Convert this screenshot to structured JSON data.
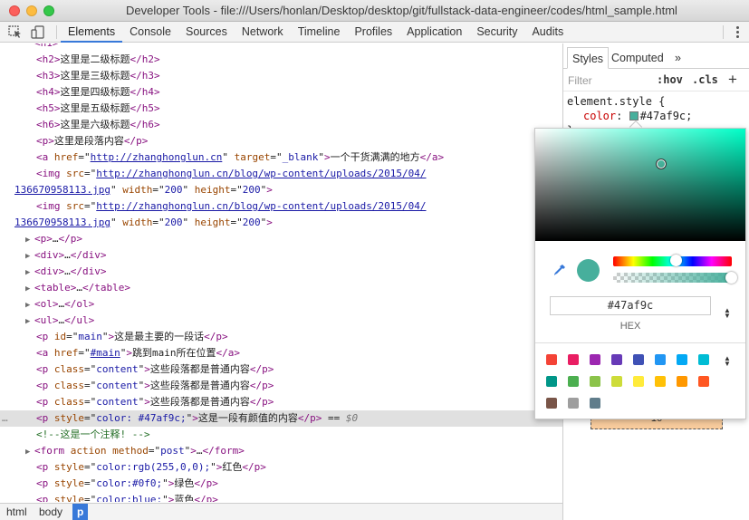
{
  "window": {
    "title": "Developer Tools - file:///Users/honlan/Desktop/desktop/git/fullstack-data-engineer/codes/html_sample.html"
  },
  "toolbar": {
    "tabs": [
      "Elements",
      "Console",
      "Sources",
      "Network",
      "Timeline",
      "Profiles",
      "Application",
      "Security",
      "Audits"
    ],
    "active_tab": "Elements"
  },
  "dom": {
    "lines": [
      {
        "indent": 3,
        "tokens": [
          [
            "tag",
            "<h2>"
          ],
          [
            "txt",
            "这里是二级标题"
          ],
          [
            "tag",
            "</h2>"
          ]
        ]
      },
      {
        "indent": 3,
        "tokens": [
          [
            "tag",
            "<h3>"
          ],
          [
            "txt",
            "这里是三级标题"
          ],
          [
            "tag",
            "</h3>"
          ]
        ]
      },
      {
        "indent": 3,
        "tokens": [
          [
            "tag",
            "<h4>"
          ],
          [
            "txt",
            "这里是四级标题"
          ],
          [
            "tag",
            "</h4>"
          ]
        ]
      },
      {
        "indent": 3,
        "tokens": [
          [
            "tag",
            "<h5>"
          ],
          [
            "txt",
            "这里是五级标题"
          ],
          [
            "tag",
            "</h5>"
          ]
        ]
      },
      {
        "indent": 3,
        "tokens": [
          [
            "tag",
            "<h6>"
          ],
          [
            "txt",
            "这里是六级标题"
          ],
          [
            "tag",
            "</h6>"
          ]
        ]
      },
      {
        "indent": 3,
        "tokens": [
          [
            "tag",
            "<p>"
          ],
          [
            "txt",
            "这里是段落内容"
          ],
          [
            "tag",
            "</p>"
          ]
        ]
      },
      {
        "indent": 3,
        "tokens": [
          [
            "tag",
            "<a "
          ],
          [
            "attr",
            "href"
          ],
          [
            "eq",
            "=\""
          ],
          [
            "link",
            "http://zhanghonglun.cn"
          ],
          [
            "eq",
            "\" "
          ],
          [
            "attr",
            "target"
          ],
          [
            "eq",
            "=\""
          ],
          [
            "val",
            "_blank"
          ],
          [
            "eq",
            "\""
          ],
          [
            "tag",
            ">"
          ],
          [
            "txt",
            "一个干货满满的地方"
          ],
          [
            "tag",
            "</a>"
          ]
        ]
      },
      {
        "indent": 3,
        "tokens": [
          [
            "tag",
            "<img "
          ],
          [
            "attr",
            "src"
          ],
          [
            "eq",
            "=\""
          ],
          [
            "link",
            "http://zhanghonglun.cn/blog/wp-content/uploads/2015/04/"
          ]
        ]
      },
      {
        "indent": 1,
        "tokens": [
          [
            "link",
            "136670958113.jpg"
          ],
          [
            "eq",
            "\" "
          ],
          [
            "attr",
            "width"
          ],
          [
            "eq",
            "=\""
          ],
          [
            "val",
            "200"
          ],
          [
            "eq",
            "\" "
          ],
          [
            "attr",
            "height"
          ],
          [
            "eq",
            "=\""
          ],
          [
            "val",
            "200"
          ],
          [
            "eq",
            "\""
          ],
          [
            "tag",
            ">"
          ]
        ]
      },
      {
        "indent": 3,
        "tokens": [
          [
            "tag",
            "<img "
          ],
          [
            "attr",
            "src"
          ],
          [
            "eq",
            "=\""
          ],
          [
            "link",
            "http://zhanghonglun.cn/blog/wp-content/uploads/2015/04/"
          ]
        ]
      },
      {
        "indent": 1,
        "tokens": [
          [
            "link",
            "136670958113.jpg"
          ],
          [
            "eq",
            "\" "
          ],
          [
            "attr",
            "width"
          ],
          [
            "eq",
            "=\""
          ],
          [
            "val",
            "200"
          ],
          [
            "eq",
            "\" "
          ],
          [
            "attr",
            "height"
          ],
          [
            "eq",
            "=\""
          ],
          [
            "val",
            "200"
          ],
          [
            "eq",
            "\""
          ],
          [
            "tag",
            ">"
          ]
        ]
      },
      {
        "indent": 2,
        "arrow": true,
        "tokens": [
          [
            "tag",
            "<p>"
          ],
          [
            "txt",
            "…"
          ],
          [
            "tag",
            "</p>"
          ]
        ]
      },
      {
        "indent": 2,
        "arrow": true,
        "tokens": [
          [
            "tag",
            "<div>"
          ],
          [
            "txt",
            "…"
          ],
          [
            "tag",
            "</div>"
          ]
        ]
      },
      {
        "indent": 2,
        "arrow": true,
        "tokens": [
          [
            "tag",
            "<div>"
          ],
          [
            "txt",
            "…"
          ],
          [
            "tag",
            "</div>"
          ]
        ]
      },
      {
        "indent": 2,
        "arrow": true,
        "tokens": [
          [
            "tag",
            "<table>"
          ],
          [
            "txt",
            "…"
          ],
          [
            "tag",
            "</table>"
          ]
        ]
      },
      {
        "indent": 2,
        "arrow": true,
        "tokens": [
          [
            "tag",
            "<ol>"
          ],
          [
            "txt",
            "…"
          ],
          [
            "tag",
            "</ol>"
          ]
        ]
      },
      {
        "indent": 2,
        "arrow": true,
        "tokens": [
          [
            "tag",
            "<ul>"
          ],
          [
            "txt",
            "…"
          ],
          [
            "tag",
            "</ul>"
          ]
        ]
      },
      {
        "indent": 3,
        "tokens": [
          [
            "tag",
            "<p "
          ],
          [
            "attr",
            "id"
          ],
          [
            "eq",
            "=\""
          ],
          [
            "val",
            "main"
          ],
          [
            "eq",
            "\""
          ],
          [
            "tag",
            ">"
          ],
          [
            "txt",
            "这是最主要的一段话"
          ],
          [
            "tag",
            "</p>"
          ]
        ]
      },
      {
        "indent": 3,
        "tokens": [
          [
            "tag",
            "<a "
          ],
          [
            "attr",
            "href"
          ],
          [
            "eq",
            "=\""
          ],
          [
            "link",
            "#main"
          ],
          [
            "eq",
            "\""
          ],
          [
            "tag",
            ">"
          ],
          [
            "txt",
            "跳到main所在位置"
          ],
          [
            "tag",
            "</a>"
          ]
        ]
      },
      {
        "indent": 3,
        "tokens": [
          [
            "tag",
            "<p "
          ],
          [
            "attr",
            "class"
          ],
          [
            "eq",
            "=\""
          ],
          [
            "val",
            "content"
          ],
          [
            "eq",
            "\""
          ],
          [
            "tag",
            ">"
          ],
          [
            "txt",
            "这些段落都是普通内容"
          ],
          [
            "tag",
            "</p>"
          ]
        ]
      },
      {
        "indent": 3,
        "tokens": [
          [
            "tag",
            "<p "
          ],
          [
            "attr",
            "class"
          ],
          [
            "eq",
            "=\""
          ],
          [
            "val",
            "content"
          ],
          [
            "eq",
            "\""
          ],
          [
            "tag",
            ">"
          ],
          [
            "txt",
            "这些段落都是普通内容"
          ],
          [
            "tag",
            "</p>"
          ]
        ]
      },
      {
        "indent": 3,
        "tokens": [
          [
            "tag",
            "<p "
          ],
          [
            "attr",
            "class"
          ],
          [
            "eq",
            "=\""
          ],
          [
            "val",
            "content"
          ],
          [
            "eq",
            "\""
          ],
          [
            "tag",
            ">"
          ],
          [
            "txt",
            "这些段落都是普通内容"
          ],
          [
            "tag",
            "</p>"
          ]
        ]
      },
      {
        "indent": 3,
        "selected": true,
        "tokens": [
          [
            "tag",
            "<p "
          ],
          [
            "attr",
            "style"
          ],
          [
            "eq",
            "=\""
          ],
          [
            "val",
            "color: #47af9c;"
          ],
          [
            "eq",
            "\""
          ],
          [
            "tag",
            ">"
          ],
          [
            "txt",
            "这是一段有颜值的内容"
          ],
          [
            "tag",
            "</p>"
          ],
          [
            "eq",
            " == "
          ],
          [
            "dim",
            "$0"
          ]
        ]
      },
      {
        "indent": 3,
        "tokens": [
          [
            "cmt",
            "<!--这是一个注释! -->"
          ]
        ]
      },
      {
        "indent": 2,
        "arrow": true,
        "tokens": [
          [
            "tag",
            "<form "
          ],
          [
            "attr",
            "action"
          ],
          [
            "eq",
            " "
          ],
          [
            "attr",
            "method"
          ],
          [
            "eq",
            "=\""
          ],
          [
            "val",
            "post"
          ],
          [
            "eq",
            "\""
          ],
          [
            "tag",
            ">"
          ],
          [
            "txt",
            "…"
          ],
          [
            "tag",
            "</form>"
          ]
        ]
      },
      {
        "indent": 3,
        "tokens": [
          [
            "tag",
            "<p "
          ],
          [
            "attr",
            "style"
          ],
          [
            "eq",
            "=\""
          ],
          [
            "val",
            "color:rgb(255,0,0);"
          ],
          [
            "eq",
            "\""
          ],
          [
            "tag",
            ">"
          ],
          [
            "txt",
            "红色"
          ],
          [
            "tag",
            "</p>"
          ]
        ]
      },
      {
        "indent": 3,
        "tokens": [
          [
            "tag",
            "<p "
          ],
          [
            "attr",
            "style"
          ],
          [
            "eq",
            "=\""
          ],
          [
            "val",
            "color:#0f0;"
          ],
          [
            "eq",
            "\""
          ],
          [
            "tag",
            ">"
          ],
          [
            "txt",
            "绿色"
          ],
          [
            "tag",
            "</p>"
          ]
        ]
      },
      {
        "indent": 3,
        "tokens": [
          [
            "tag",
            "<p "
          ],
          [
            "attr",
            "style"
          ],
          [
            "eq",
            "=\""
          ],
          [
            "val",
            "color:blue;"
          ],
          [
            "eq",
            "\""
          ],
          [
            "tag",
            ">"
          ],
          [
            "txt",
            "蓝色"
          ],
          [
            "tag",
            "</p>"
          ]
        ]
      },
      {
        "indent": 2,
        "tokens": [
          [
            "tag",
            "</body>"
          ]
        ]
      },
      {
        "indent": 1,
        "tokens": [
          [
            "tag",
            "</html>"
          ]
        ]
      }
    ]
  },
  "breadcrumb": {
    "items": [
      "html",
      "body",
      "p"
    ],
    "active": "p"
  },
  "styles": {
    "tabs": [
      "Styles",
      "Computed"
    ],
    "more": "»",
    "filter_placeholder": "Filter",
    "hov": ":hov",
    "cls": ".cls",
    "add": "+",
    "selector": "element.style {",
    "property": "color",
    "value": "#47af9c;",
    "closing": "}",
    "box_value": "16"
  },
  "picker": {
    "hex_value": "#47af9c",
    "format_label": "HEX",
    "swatch_color": "#47af9c",
    "palette": [
      "#f44336",
      "#e91e63",
      "#9c27b0",
      "#673ab7",
      "#3f51b5",
      "#2196f3",
      "#03a9f4",
      "#00bcd4",
      "#009688",
      "#4caf50",
      "#8bc34a",
      "#cddc39",
      "#ffeb3b",
      "#ffc107",
      "#ff9800",
      "#ff5722",
      "#795548",
      "#9e9e9e",
      "#607d8b"
    ]
  }
}
